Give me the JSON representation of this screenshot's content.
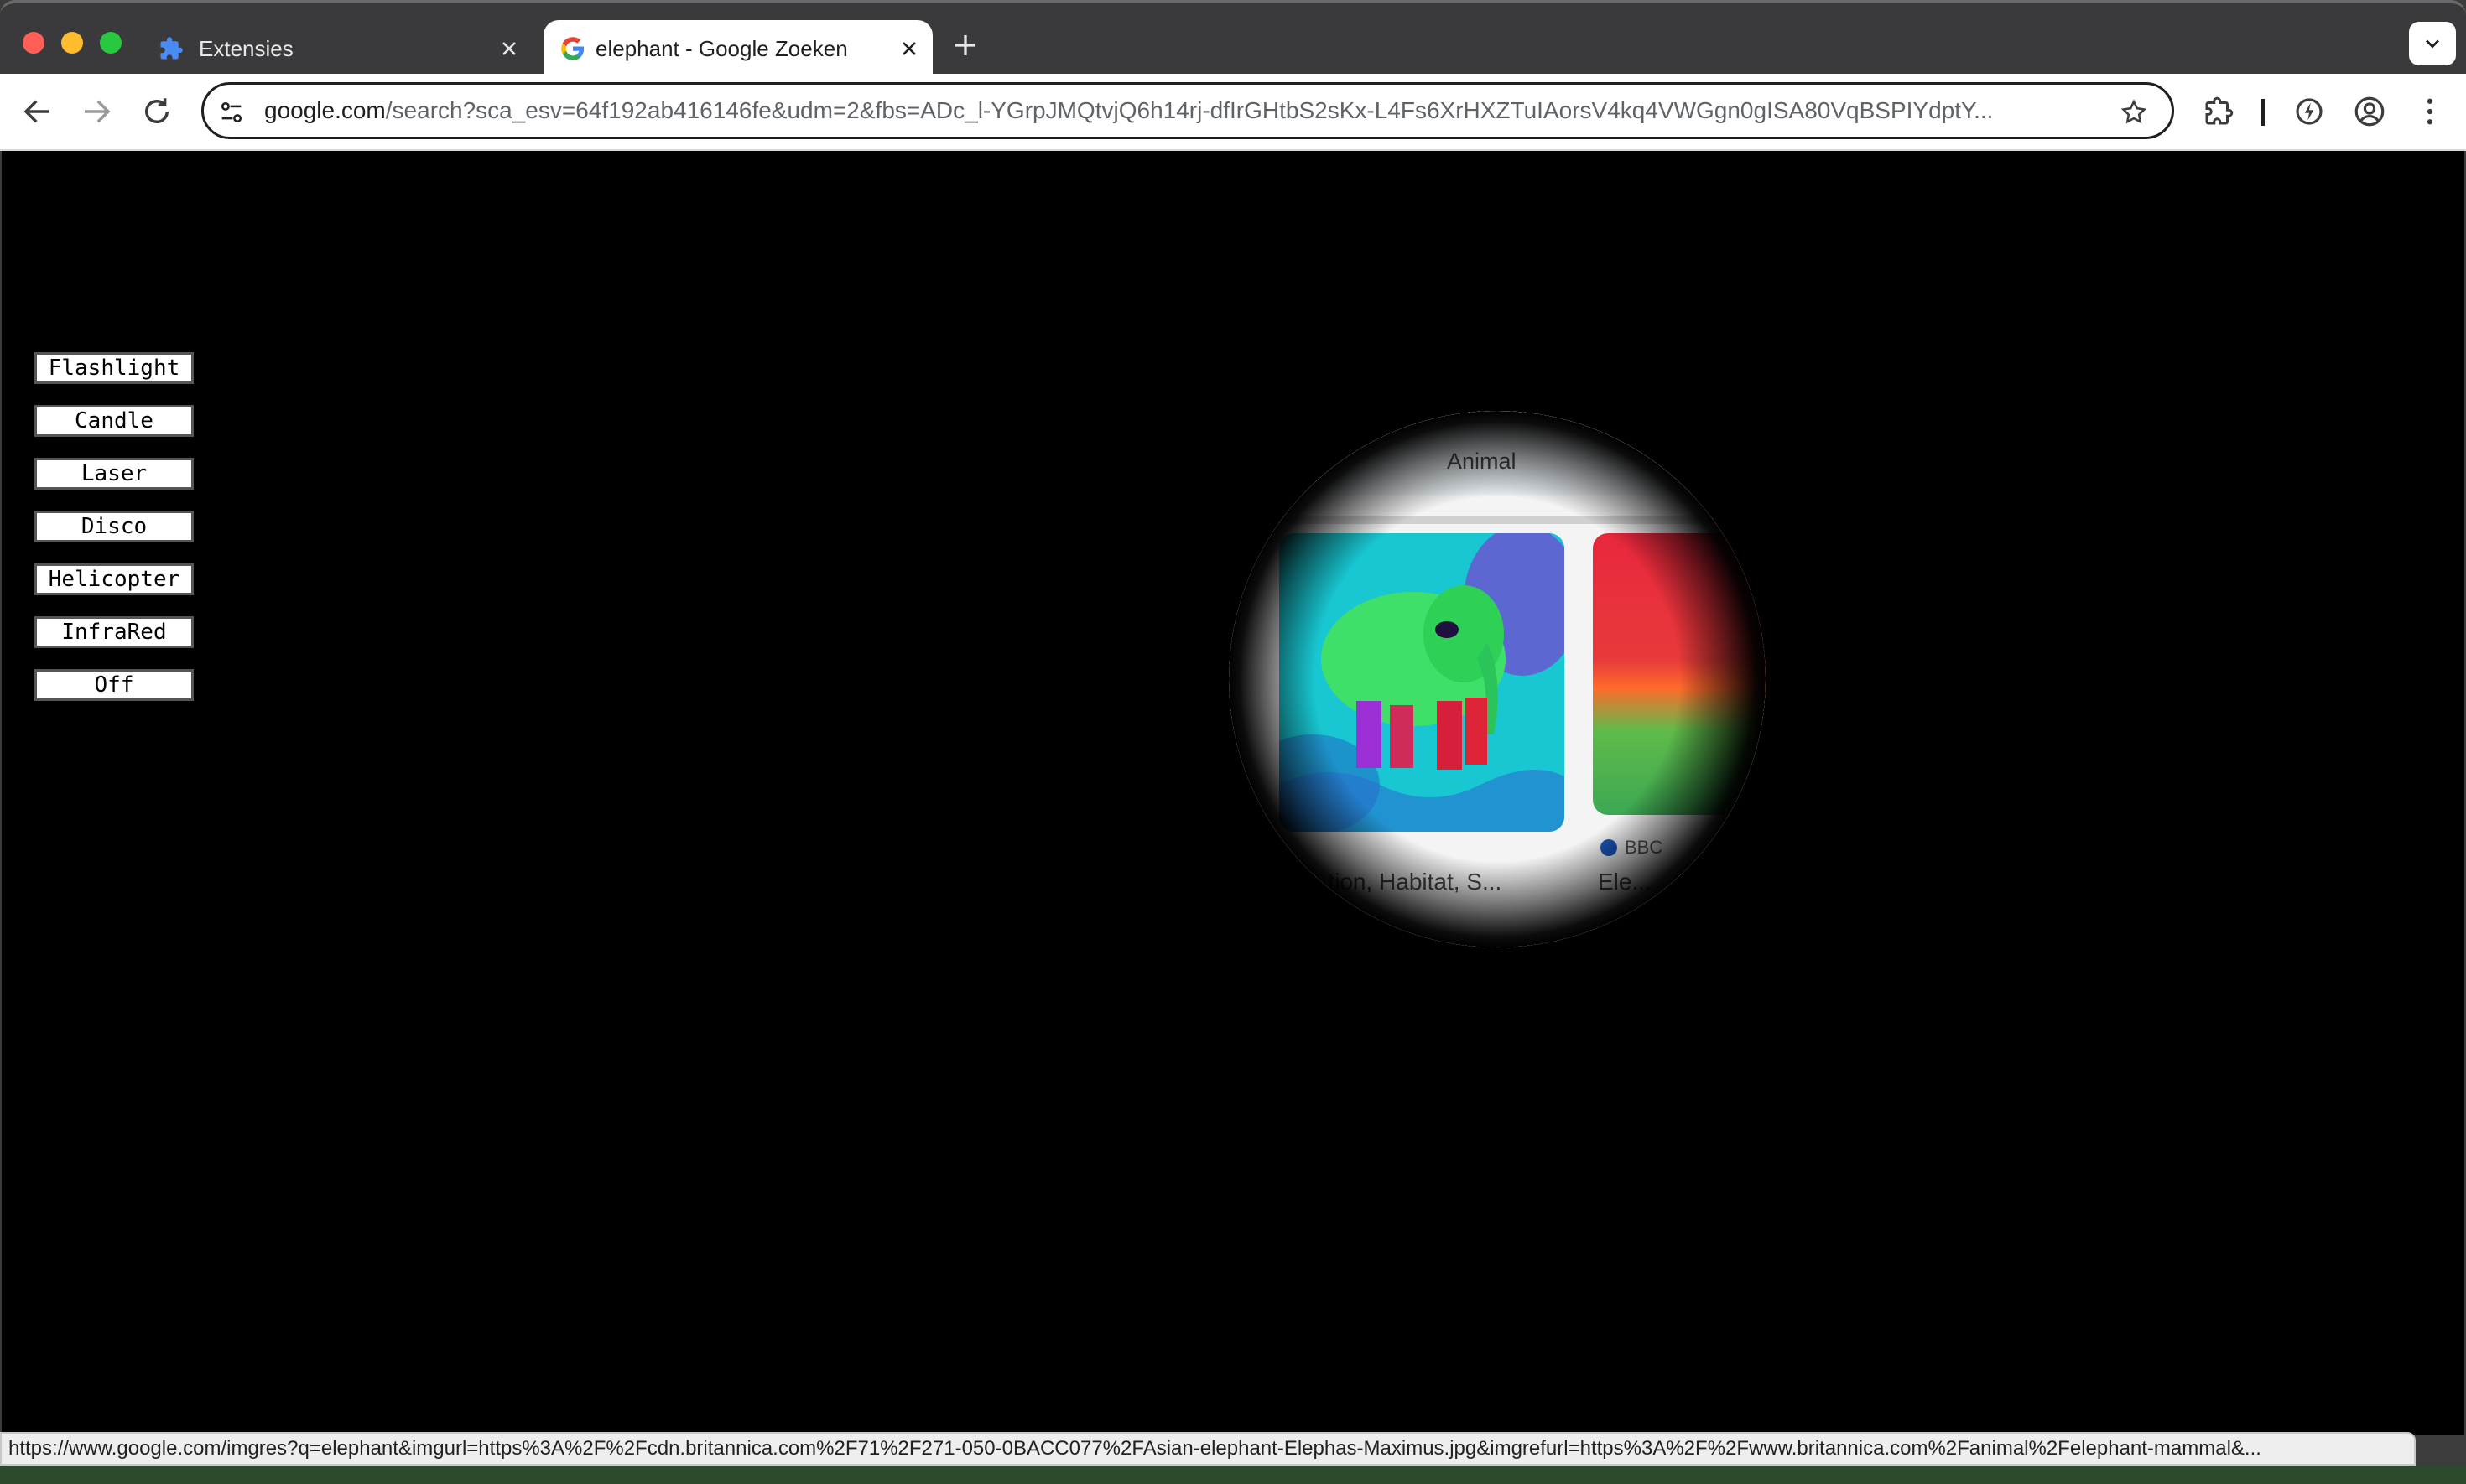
{
  "tabs": [
    {
      "title": "Extensies",
      "icon": "puzzle-icon",
      "active": false
    },
    {
      "title": "elephant - Google Zoeken",
      "icon": "google-g-icon",
      "active": true
    }
  ],
  "toolbar": {
    "url_host": "google.com",
    "url_rest": "/search?sca_esv=64f192ab416146fe&udm=2&fbs=ADc_l-YGrpJMQtvjQ6h14rj-dfIrGHtbS2sKx-L4Fs6XrHXZTuIAorsV4kq4VWGgn0gISA80VqBSPIYdptY..."
  },
  "effects": {
    "buttons": [
      "Flashlight",
      "Candle",
      "Laser",
      "Disco",
      "Helicopter",
      "InfraRed",
      "Off"
    ]
  },
  "spotlight": {
    "chip_label": "Animal",
    "source2": "BBC",
    "caption1": "...tion, Habitat, S...",
    "caption2": "Ele..."
  },
  "status": {
    "link": "https://www.google.com/imgres?q=elephant&imgurl=https%3A%2F%2Fcdn.britannica.com%2F71%2F271-050-0BACC077%2FAsian-elephant-Elephas-Maximus.jpg&imgrefurl=https%3A%2F%2Fwww.britannica.com%2Fanimal%2Felephant-mammal&..."
  },
  "colors": {
    "accent_blue": "#1a73e8",
    "overlay": "#000000",
    "traffic_red": "#ff5f57",
    "traffic_yellow": "#febc2e",
    "traffic_green": "#28c840"
  }
}
